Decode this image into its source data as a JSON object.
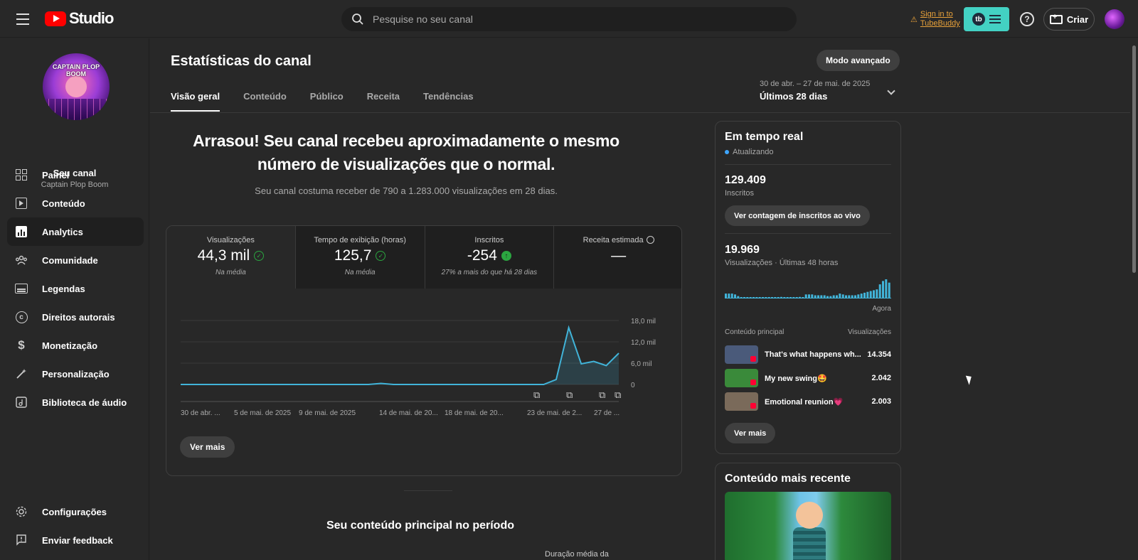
{
  "app": {
    "brand": "Studio",
    "search_placeholder": "Pesquise no seu canal",
    "tubebuddy_signin_line1": "Sign in to",
    "tubebuddy_signin_line2": "TubeBuddy",
    "tubebuddy_logo": "tb",
    "help_glyph": "?",
    "create_label": "Criar"
  },
  "sidebar": {
    "avatar_title": "CAPTAIN PLOP BOOM",
    "channel_label": "Seu canal",
    "channel_name": "Captain Plop Boom",
    "items": [
      {
        "label": "Painel",
        "icon": "dashboard-icon"
      },
      {
        "label": "Conteúdo",
        "icon": "content-icon"
      },
      {
        "label": "Analytics",
        "icon": "analytics-icon",
        "active": true
      },
      {
        "label": "Comunidade",
        "icon": "community-icon"
      },
      {
        "label": "Legendas",
        "icon": "subtitles-icon"
      },
      {
        "label": "Direitos autorais",
        "icon": "copyright-icon"
      },
      {
        "label": "Monetização",
        "icon": "monetization-icon"
      },
      {
        "label": "Personalização",
        "icon": "customization-icon"
      },
      {
        "label": "Biblioteca de áudio",
        "icon": "audio-library-icon"
      }
    ],
    "bottom": [
      {
        "label": "Configurações",
        "icon": "gear-icon"
      },
      {
        "label": "Enviar feedback",
        "icon": "feedback-icon"
      }
    ]
  },
  "main": {
    "title": "Estatísticas do canal",
    "advanced_mode": "Modo avançado",
    "tabs": [
      "Visão geral",
      "Conteúdo",
      "Público",
      "Receita",
      "Tendências"
    ],
    "period_range": "30 de abr. – 27 de mai. de 2025",
    "period_label": "Últimos 28 dias",
    "headline": "Arrasou! Seu canal recebeu aproximadamente o mesmo número de visualizações que o normal.",
    "subline": "Seu canal costuma receber de 790 a 1.283.000 visualizações em 28 dias.",
    "kpis": [
      {
        "label": "Visualizações",
        "value": "44,3 mil",
        "note": "Na média",
        "status": "check"
      },
      {
        "label": "Tempo de exibição (horas)",
        "value": "125,7",
        "note": "Na média",
        "status": "check"
      },
      {
        "label": "Inscritos",
        "value": "-254",
        "note": "27% a mais do que há 28 dias",
        "status": "up"
      },
      {
        "label": "Receita estimada",
        "value": "—",
        "note": "",
        "status": "clock"
      }
    ],
    "see_more": "Ver mais",
    "section_title": "Seu conteúdo principal no período",
    "duration_label": "Duração média da"
  },
  "chart_data": {
    "type": "area",
    "series": [
      {
        "values": [
          0,
          0,
          0,
          0,
          0,
          0,
          0,
          0,
          0,
          0,
          0,
          0,
          0,
          0,
          0,
          0,
          300,
          0,
          0,
          0,
          0,
          0,
          0,
          0,
          0,
          0,
          0,
          0,
          0,
          0,
          1400,
          16000,
          5800,
          6500,
          5300,
          8800
        ]
      }
    ],
    "x_tick_labels": [
      "30 de abr. ...",
      "5 de mai. de 2025",
      "9 de mai. de 2025",
      "14 de mai. de 20...",
      "18 de mai. de 20...",
      "23 de mai. de 2...",
      "27 de ..."
    ],
    "y_tick_labels": [
      "18,0 mil",
      "12,0 mil",
      "6,0 mil",
      "0"
    ],
    "ylim": [
      0,
      18000
    ],
    "color": "#41b4d9",
    "grid": true
  },
  "realtime": {
    "title": "Em tempo real",
    "status": "Atualizando",
    "subs_value": "129.409",
    "subs_label": "Inscritos",
    "subs_button": "Ver contagem de inscritos ao vivo",
    "views_value": "19.969",
    "views_label": "Visualizações · Últimas 48 horas",
    "bars": [
      5,
      5,
      5,
      4,
      2,
      0,
      0,
      0,
      0,
      0,
      0,
      0,
      0,
      0,
      0,
      0,
      0,
      0,
      1,
      0,
      0,
      0,
      0,
      0,
      1,
      0,
      4,
      4,
      4,
      3,
      3,
      3,
      3,
      2,
      2,
      3,
      3,
      5,
      4,
      3,
      3,
      3,
      3,
      4,
      5,
      6,
      7,
      8,
      9,
      10,
      16,
      20,
      22,
      18
    ],
    "now_label": "Agora",
    "top_header_left": "Conteúdo principal",
    "top_header_right": "Visualizações",
    "top": [
      {
        "title": "That's what happens wh...",
        "views": "14.354",
        "thumb": "#4a5a7a"
      },
      {
        "title": "My new swing🤩",
        "views": "2.042",
        "thumb": "#3a8a3a"
      },
      {
        "title": "Emotional reunion💗",
        "views": "2.003",
        "thumb": "#7a6a5a"
      }
    ],
    "see_more": "Ver mais"
  },
  "recent": {
    "title": "Conteúdo mais recente"
  }
}
